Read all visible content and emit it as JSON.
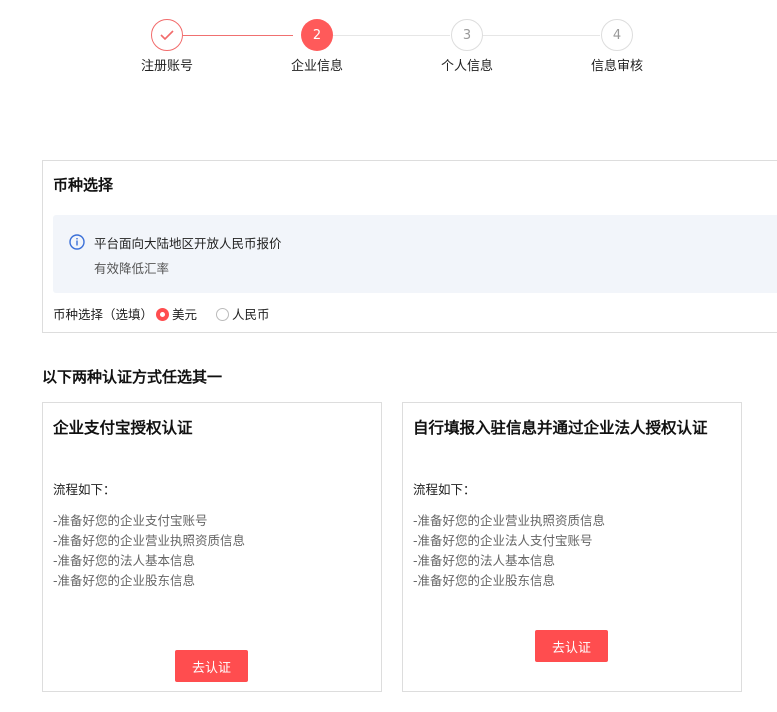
{
  "steps": [
    {
      "label": "注册账号",
      "state": "done",
      "icon": "check-icon"
    },
    {
      "label": "企业信息",
      "num": "2",
      "state": "current"
    },
    {
      "label": "个人信息",
      "num": "3",
      "state": "todo"
    },
    {
      "label": "信息审核",
      "num": "4",
      "state": "todo"
    }
  ],
  "currency": {
    "title": "币种选择",
    "notice_line1": "平台面向大陆地区开放人民币报价",
    "notice_line2": "有效降低汇率",
    "field_label": "币种选择（选填）",
    "options": [
      "美元",
      "人民币"
    ],
    "selected": "美元"
  },
  "section_title": "以下两种认证方式任选其一",
  "cards": [
    {
      "title": "企业支付宝授权认证",
      "flow_label": "流程如下：",
      "items": [
        "-准备好您的企业支付宝账号",
        "-准备好您的企业营业执照资质信息",
        "-准备好您的法人基本信息",
        "-准备好您的企业股东信息"
      ],
      "button": "去认证"
    },
    {
      "title": "自行填报入驻信息并通过企业法人授权认证",
      "flow_label": "流程如下：",
      "items": [
        "-准备好您的企业营业执照资质信息",
        "-准备好您的企业法人支付宝账号",
        "-准备好您的法人基本信息",
        "-准备好您的企业股东信息"
      ],
      "button": "去认证"
    }
  ],
  "colors": {
    "accent": "#ff4d4f",
    "info": "#3a6fd8"
  }
}
